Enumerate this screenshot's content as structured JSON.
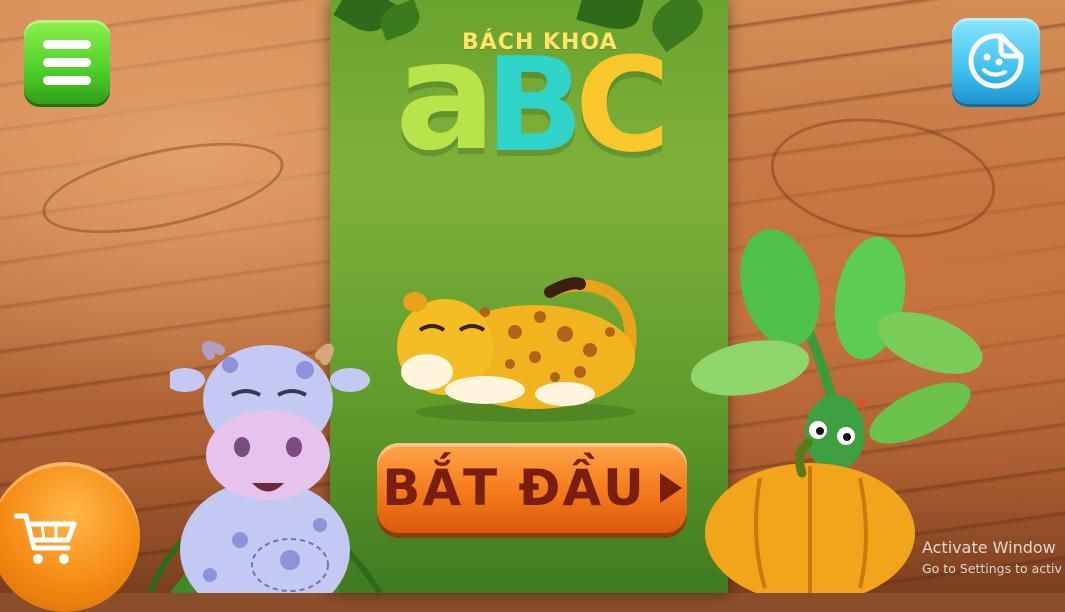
{
  "app": {
    "brand_line": "BÁCH KHOA",
    "logo_letters": [
      "a",
      "B",
      "C"
    ]
  },
  "buttons": {
    "start_label": "BẮT ĐẦU"
  },
  "icons": {
    "menu": "hamburger-menu-icon",
    "sticker": "sticker-icon",
    "cart": "shopping-cart-icon",
    "play": "play-triangle-icon"
  },
  "windows_watermark": {
    "line1": "Activate Window",
    "line2": "Go to Settings to activ"
  },
  "colors": {
    "panel_green": "#6aa32e",
    "start_orange": "#f47a1a",
    "start_text": "#7a1e10",
    "menu_green": "#4fcf2a",
    "sticker_blue": "#3fc0f0",
    "logo_a": "#b9e34a",
    "logo_b": "#2fd3c7",
    "logo_c": "#f7c72c"
  }
}
